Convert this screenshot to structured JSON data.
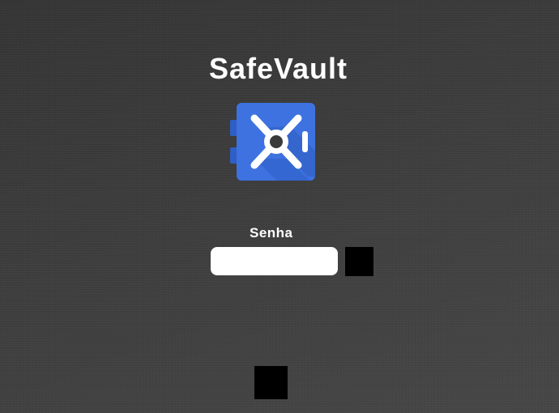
{
  "app": {
    "title": "SafeVault",
    "logo_icon": "safe-vault-icon",
    "brand_color": "#3367d6"
  },
  "login": {
    "password_label": "Senha",
    "password_value": "",
    "password_placeholder": "",
    "submit_icon": "submit-icon"
  },
  "footer": {
    "button_icon": "action-icon"
  }
}
